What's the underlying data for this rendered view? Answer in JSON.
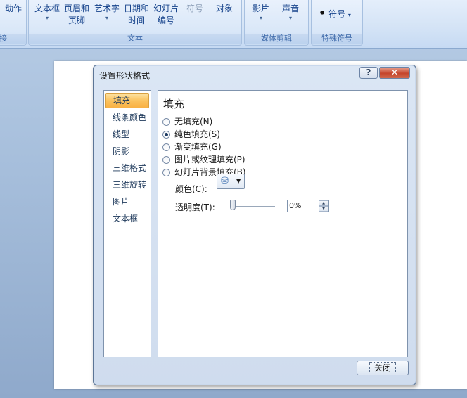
{
  "ribbon": {
    "partial_left_label": "动作",
    "partial_left_group": "接",
    "text_group": {
      "label": "文本",
      "buttons": [
        {
          "line1": "文本框",
          "line2": ""
        },
        {
          "line1": "页眉和",
          "line2": "页脚"
        },
        {
          "line1": "艺术字",
          "line2": ""
        },
        {
          "line1": "日期和",
          "line2": "时间"
        },
        {
          "line1": "幻灯片",
          "line2": "编号"
        },
        {
          "line1": "符号",
          "line2": ""
        },
        {
          "line1": "对象",
          "line2": ""
        }
      ]
    },
    "media_group": {
      "label": "媒体剪辑",
      "buttons": [
        {
          "line1": "影片"
        },
        {
          "line1": "声音"
        }
      ]
    },
    "symbols_group": {
      "label": "特殊符号",
      "dot": "•",
      "button": "符号"
    }
  },
  "dialog": {
    "title": "设置形状格式",
    "help_label": "?",
    "close_label": "✕",
    "nav_items": [
      {
        "label": "填充",
        "selected": true
      },
      {
        "label": "线条颜色",
        "selected": false
      },
      {
        "label": "线型",
        "selected": false
      },
      {
        "label": "阴影",
        "selected": false
      },
      {
        "label": "三维格式",
        "selected": false
      },
      {
        "label": "三维旋转",
        "selected": false
      },
      {
        "label": "图片",
        "selected": false
      },
      {
        "label": "文本框",
        "selected": false
      }
    ],
    "section_title": "填充",
    "fill_options": [
      {
        "label": "无填充(N)",
        "checked": false
      },
      {
        "label": "纯色填充(S)",
        "checked": true
      },
      {
        "label": "渐变填充(G)",
        "checked": false
      },
      {
        "label": "图片或纹理填充(P)",
        "checked": false
      },
      {
        "label": "幻灯片背景填充(B)",
        "checked": false
      }
    ],
    "color_label": "颜色(C):",
    "transparency_label": "透明度(T):",
    "transparency_value": "0%",
    "transparency_fraction": 0,
    "footer_close": "关闭"
  },
  "icons": {
    "paint_bucket": "paint-bucket-icon",
    "dropdown": "chevron-down-icon"
  }
}
